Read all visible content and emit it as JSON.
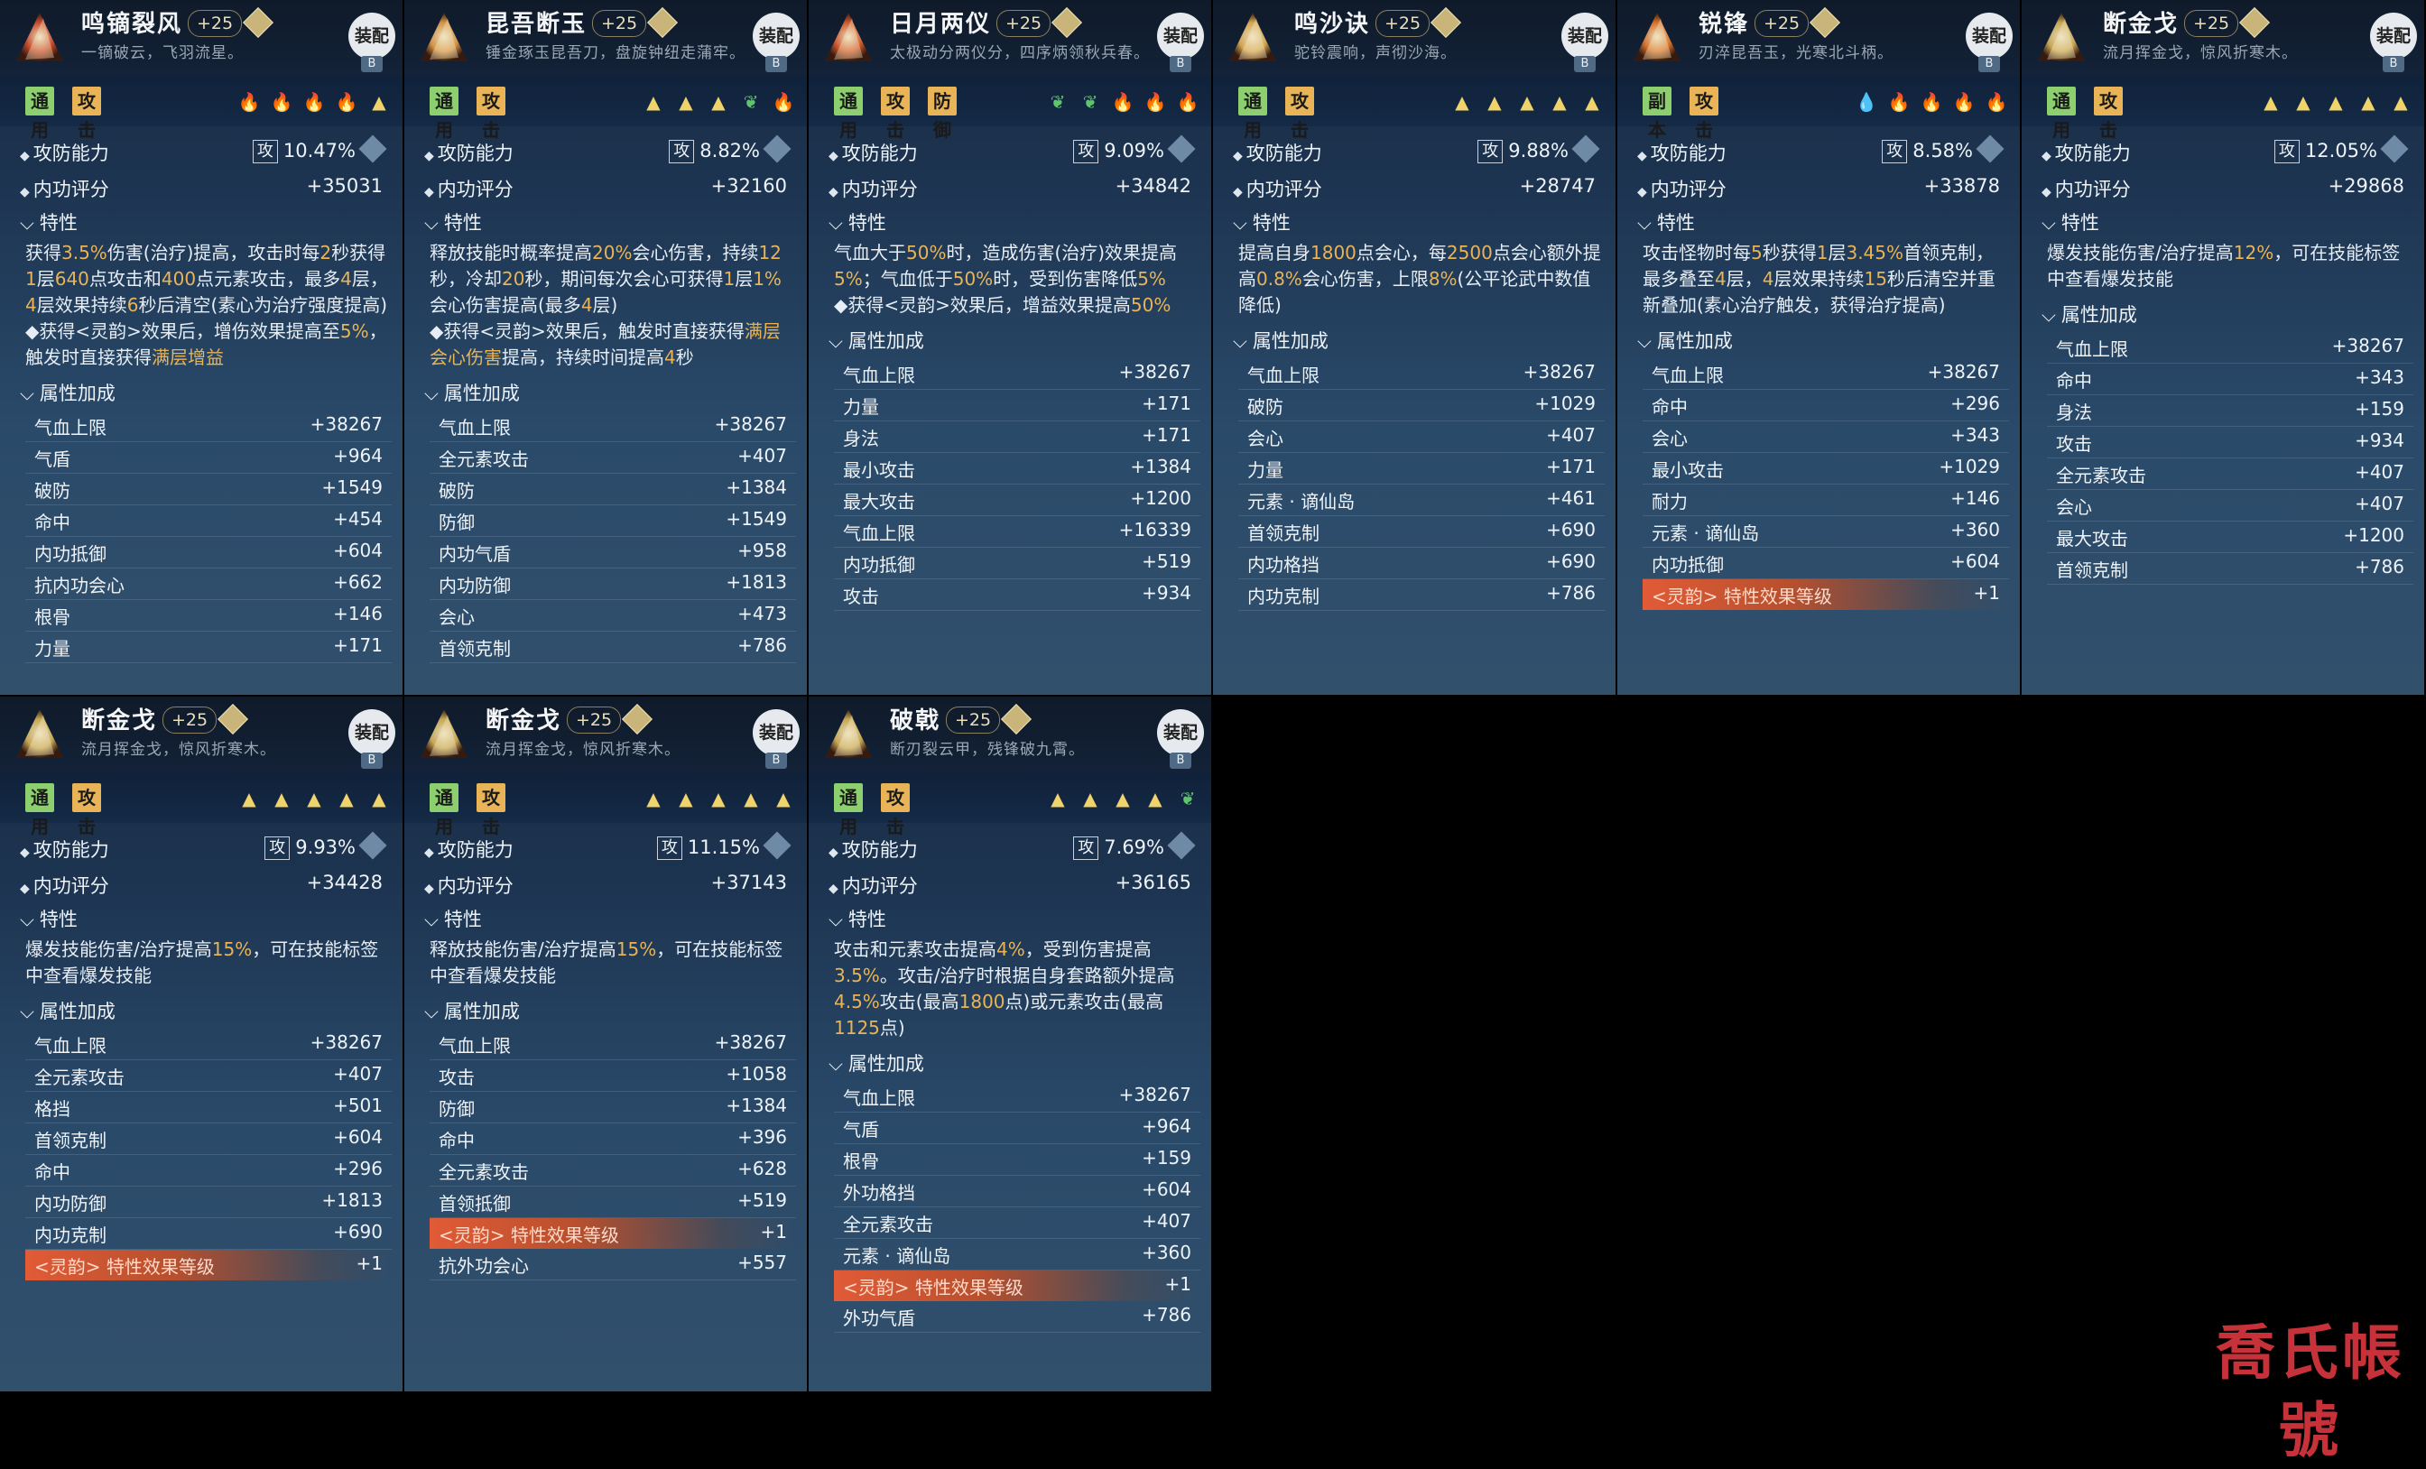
{
  "equip_label": "装配",
  "equip_badge": "B",
  "stat_attack_label": "攻防能力",
  "stat_inner_label": "内功评分",
  "attack_marker": "攻",
  "section_trait": "特性",
  "section_attr": "属性加成",
  "watermark": "喬氏帳號",
  "cards": [
    {
      "name": "鸣镝裂风",
      "plus": "+25",
      "desc": "一镝破云，飞羽流星。",
      "tags": [
        "通用",
        "攻击"
      ],
      "icons": [
        "fire",
        "fire",
        "fire",
        "fire",
        "tri"
      ],
      "attack_pct": "10.47%",
      "inner": "+35031",
      "trait_text": "获得3.5%伤害(治疗)提高，攻击时每2秒获得1层640点攻击和400点元素攻击，最多4层，4层效果持续6秒后清空(素心为治疗强度提高)",
      "trait_note": "◆获得<灵韵>效果后，增伤效果提高至5%，触发时直接获得满层增益",
      "attrs": [
        [
          "气血上限",
          "+38267"
        ],
        [
          "气盾",
          "+964"
        ],
        [
          "破防",
          "+1549"
        ],
        [
          "命中",
          "+454"
        ],
        [
          "内功抵御",
          "+604"
        ],
        [
          "抗内功会心",
          "+662"
        ],
        [
          "根骨",
          "+146"
        ],
        [
          "力量",
          "+171"
        ]
      ]
    },
    {
      "name": "昆吾断玉",
      "plus": "+25",
      "desc": "锤金琢玉昆吾刀，盘旋钟纽走蒲牢。",
      "tags": [
        "通用",
        "攻击"
      ],
      "icons": [
        "tri",
        "tri",
        "tri",
        "leaf",
        "fire"
      ],
      "attack_pct": "8.82%",
      "inner": "+32160",
      "trait_text": "释放技能时概率提高20%会心伤害，持续12秒，冷却20秒，期间每次会心可获得1层1%会心伤害提高(最多4层)",
      "trait_note": "◆获得<灵韵>效果后，触发时直接获得满层会心伤害提高，持续时间提高4秒",
      "attrs": [
        [
          "气血上限",
          "+38267"
        ],
        [
          "全元素攻击",
          "+407"
        ],
        [
          "破防",
          "+1384"
        ],
        [
          "防御",
          "+1549"
        ],
        [
          "内功气盾",
          "+958"
        ],
        [
          "内功防御",
          "+1813"
        ],
        [
          "会心",
          "+473"
        ],
        [
          "首领克制",
          "+786"
        ]
      ]
    },
    {
      "name": "日月两仪",
      "plus": "+25",
      "desc": "太极动分两仪分，四序炳领秋兵春。",
      "tags": [
        "通用",
        "攻击",
        "防御"
      ],
      "icons": [
        "leaf",
        "leaf",
        "fire",
        "fire",
        "fire"
      ],
      "attack_pct": "9.09%",
      "inner": "+34842",
      "trait_text": "气血大于50%时，造成伤害(治疗)效果提高5%；气血低于50%时，受到伤害降低5%",
      "trait_note": "◆获得<灵韵>效果后，增益效果提高50%",
      "attrs": [
        [
          "气血上限",
          "+38267"
        ],
        [
          "力量",
          "+171"
        ],
        [
          "身法",
          "+171"
        ],
        [
          "最小攻击",
          "+1384"
        ],
        [
          "最大攻击",
          "+1200"
        ],
        [
          "气血上限",
          "+16339"
        ],
        [
          "内功抵御",
          "+519"
        ],
        [
          "攻击",
          "+934"
        ]
      ]
    },
    {
      "name": "鸣沙诀",
      "plus": "+25",
      "desc": "驼铃震响，声彻沙海。",
      "tags": [
        "通用",
        "攻击"
      ],
      "icons": [
        "tri",
        "tri",
        "tri",
        "tri",
        "tri"
      ],
      "attack_pct": "9.88%",
      "inner": "+28747",
      "trait_text": "提高自身1800点会心，每2500点会心额外提高0.8%会心伤害，上限8%(公平论武中数值降低)",
      "trait_note": "",
      "attrs": [
        [
          "气血上限",
          "+38267"
        ],
        [
          "破防",
          "+1029"
        ],
        [
          "会心",
          "+407"
        ],
        [
          "力量",
          "+171"
        ],
        [
          "元素 · 谪仙岛",
          "+461"
        ],
        [
          "首领克制",
          "+690"
        ],
        [
          "内功格挡",
          "+690"
        ],
        [
          "内功克制",
          "+786"
        ]
      ]
    },
    {
      "name": "锐锋",
      "plus": "+25",
      "desc": "刃淬昆吾玉，光寒北斗柄。",
      "tags": [
        "副本",
        "攻击"
      ],
      "icons": [
        "drop",
        "fire",
        "fire",
        "fire",
        "fire"
      ],
      "attack_pct": "8.58%",
      "inner": "+33878",
      "trait_text": "攻击怪物时每5秒获得1层3.45%首领克制，最多叠至4层，4层效果持续15秒后清空并重新叠加(素心治疗触发，获得治疗提高)",
      "trait_note": "",
      "attrs": [
        [
          "气血上限",
          "+38267"
        ],
        [
          "命中",
          "+296"
        ],
        [
          "会心",
          "+343"
        ],
        [
          "最小攻击",
          "+1029"
        ],
        [
          "耐力",
          "+146"
        ],
        [
          "元素 · 谪仙岛",
          "+360"
        ],
        [
          "内功抵御",
          "+604"
        ],
        [
          "<灵韵> 特性效果等级",
          "+1"
        ]
      ]
    },
    {
      "name": "断金戈",
      "plus": "+25",
      "desc": "流月挥金戈，惊风折寒木。",
      "tags": [
        "通用",
        "攻击"
      ],
      "icons": [
        "tri",
        "tri",
        "tri",
        "tri",
        "tri"
      ],
      "attack_pct": "12.05%",
      "inner": "+29868",
      "trait_text": "爆发技能伤害/治疗提高12%，可在技能标签中查看爆发技能",
      "trait_note": "",
      "attrs": [
        [
          "气血上限",
          "+38267"
        ],
        [
          "命中",
          "+343"
        ],
        [
          "身法",
          "+159"
        ],
        [
          "攻击",
          "+934"
        ],
        [
          "全元素攻击",
          "+407"
        ],
        [
          "会心",
          "+407"
        ],
        [
          "最大攻击",
          "+1200"
        ],
        [
          "首领克制",
          "+786"
        ]
      ]
    },
    {
      "name": "断金戈",
      "plus": "+25",
      "desc": "流月挥金戈，惊风折寒木。",
      "tags": [
        "通用",
        "攻击"
      ],
      "icons": [
        "tri",
        "tri",
        "tri",
        "tri",
        "tri"
      ],
      "attack_pct": "9.93%",
      "inner": "+34428",
      "trait_text": "爆发技能伤害/治疗提高15%，可在技能标签中查看爆发技能",
      "trait_note": "",
      "attrs": [
        [
          "气血上限",
          "+38267"
        ],
        [
          "全元素攻击",
          "+407"
        ],
        [
          "格挡",
          "+501"
        ],
        [
          "首领克制",
          "+604"
        ],
        [
          "命中",
          "+296"
        ],
        [
          "内功防御",
          "+1813"
        ],
        [
          "内功克制",
          "+690"
        ],
        [
          "<灵韵> 特性效果等级",
          "+1"
        ]
      ]
    },
    {
      "name": "断金戈",
      "plus": "+25",
      "desc": "流月挥金戈，惊风折寒木。",
      "tags": [
        "通用",
        "攻击"
      ],
      "icons": [
        "tri",
        "tri",
        "tri",
        "tri",
        "tri"
      ],
      "attack_pct": "11.15%",
      "inner": "+37143",
      "trait_text": "释放技能伤害/治疗提高15%，可在技能标签中查看爆发技能",
      "trait_note": "",
      "attrs": [
        [
          "气血上限",
          "+38267"
        ],
        [
          "攻击",
          "+1058"
        ],
        [
          "防御",
          "+1384"
        ],
        [
          "命中",
          "+396"
        ],
        [
          "全元素攻击",
          "+628"
        ],
        [
          "首领抵御",
          "+519"
        ],
        [
          "<灵韵> 特性效果等级",
          "+1"
        ],
        [
          "抗外功会心",
          "+557"
        ]
      ]
    },
    {
      "name": "破戟",
      "plus": "+25",
      "desc": "断刃裂云甲，残锋破九霄。",
      "tags": [
        "通用",
        "攻击"
      ],
      "icons": [
        "tri",
        "tri",
        "tri",
        "tri",
        "leaf"
      ],
      "attack_pct": "7.69%",
      "inner": "+36165",
      "trait_text": "攻击和元素攻击提高4%，受到伤害提高3.5%。攻击/治疗时根据自身套路额外提高4.5%攻击(最高1800点)或元素攻击(最高1125点)",
      "trait_note": "",
      "attrs": [
        [
          "气血上限",
          "+38267"
        ],
        [
          "气盾",
          "+964"
        ],
        [
          "根骨",
          "+159"
        ],
        [
          "外功格挡",
          "+604"
        ],
        [
          "全元素攻击",
          "+407"
        ],
        [
          "元素 · 谪仙岛",
          "+360"
        ],
        [
          "<灵韵> 特性效果等级",
          "+1"
        ],
        [
          "外功气盾",
          "+786"
        ]
      ]
    }
  ]
}
